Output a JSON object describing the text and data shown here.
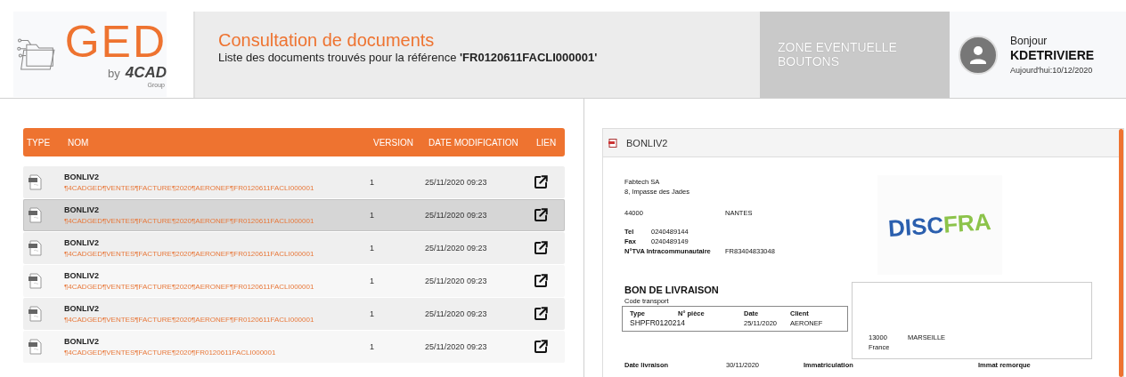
{
  "header": {
    "logo": {
      "title": "GED",
      "byline": "by",
      "brand": "4CAD",
      "brand_sub": "Group"
    },
    "title": "Consultation de documents",
    "subtitle": "Liste des documents trouvés pour la référence **'FR0120611FACLI000001'**",
    "zone": "ZONE EVENTUELLE BOUTONS",
    "user": {
      "greeting": "Bonjour",
      "name": "KDETRIVIERE",
      "date": "Aujourd'hui:10/12/2020"
    }
  },
  "table": {
    "columns": [
      "TYPE",
      "NOM",
      "VERSION",
      "DATE MODIFICATION",
      "LIEN"
    ],
    "rows": [
      {
        "name": "BONLIV2",
        "path": "¶4CADGED¶VENTES¶FACTURE¶2020¶AERONEF¶FR0120611FACLI000001",
        "version": "1",
        "date": "25/11/2020 09:23",
        "selected": false
      },
      {
        "name": "BONLIV2",
        "path": "¶4CADGED¶VENTES¶FACTURE¶2020¶AERONEF¶FR0120611FACLI000001",
        "version": "1",
        "date": "25/11/2020 09:23",
        "selected": true
      },
      {
        "name": "BONLIV2",
        "path": "¶4CADGED¶VENTES¶FACTURE¶2020¶AERONEF¶FR0120611FACLI000001",
        "version": "1",
        "date": "25/11/2020 09:23",
        "selected": false
      },
      {
        "name": "BONLIV2",
        "path": "¶4CADGED¶VENTES¶FACTURE¶2020¶AERONEF¶FR0120611FACLI000001",
        "version": "1",
        "date": "25/11/2020 09:23",
        "selected": false
      },
      {
        "name": "BONLIV2",
        "path": "¶4CADGED¶VENTES¶FACTURE¶2020¶AERONEF¶FR0120611FACLI000001",
        "version": "1",
        "date": "25/11/2020 09:23",
        "selected": false
      },
      {
        "name": "BONLIV2",
        "path": "¶4CADGED¶VENTES¶FACTURE¶2020¶FR0120611FACLI000001",
        "version": "1",
        "date": "25/11/2020 09:23",
        "selected": false
      }
    ]
  },
  "preview": {
    "title": "BONLIV2",
    "document": {
      "sender": [
        "Fabtech SA",
        "8, Impasse des Jades"
      ],
      "postcode": "44000",
      "city": "NANTES",
      "contacts": [
        {
          "label": "Tel",
          "value": "0240489144"
        },
        {
          "label": "Fax",
          "value": "0240489149"
        },
        {
          "label": "N°TVA Intracommunautaire",
          "value": "FR83404833048"
        }
      ],
      "logo": {
        "part_1": "DISC",
        "part_2": "FRA"
      },
      "doc_title": "BON DE LIVRAISON",
      "code_label": "Code transport",
      "transport": {
        "columns": [
          "Type",
          "N° pièce",
          "Date",
          "Client"
        ],
        "number": "SHPFR0120214",
        "date": "25/11/2020",
        "client": "AERONEF"
      },
      "recipient": {
        "postcode": "13000",
        "city": "MARSEILLE",
        "country": "France"
      },
      "footer": [
        {
          "label": "Date livraison",
          "value": "30/11/2020"
        },
        {
          "label": "Immatriculation"
        },
        {
          "label": "Immat remorque"
        }
      ]
    }
  }
}
